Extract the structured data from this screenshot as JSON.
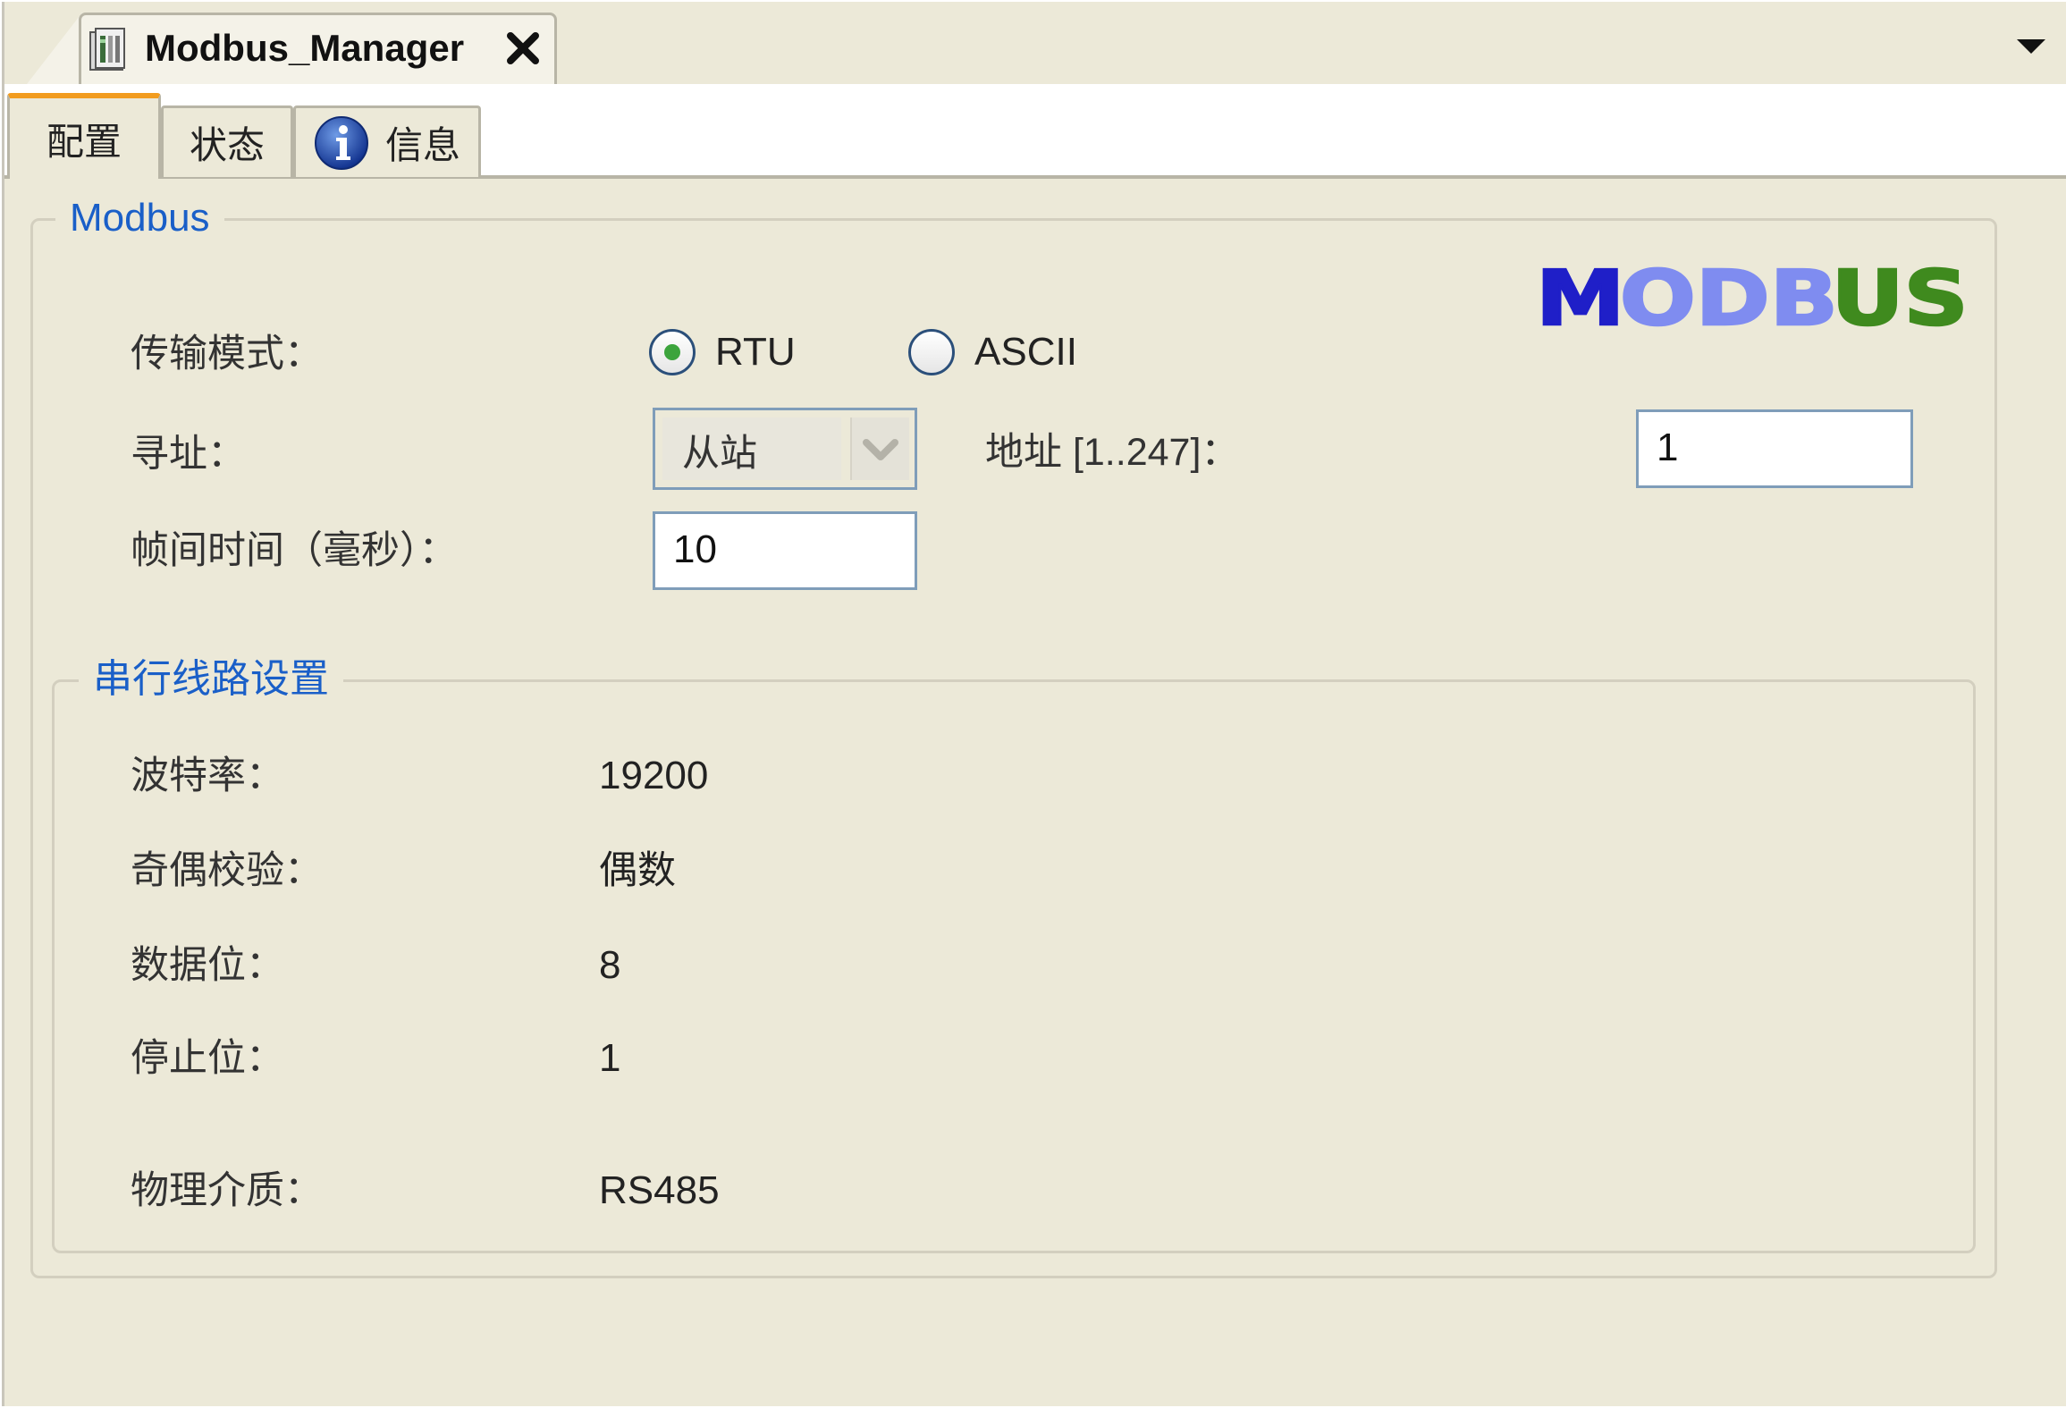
{
  "editor_tab": {
    "title": "Modbus_Manager",
    "icon": "device-manager-icon",
    "close_icon": "close-icon"
  },
  "tab_list_icon": "triangle-down-icon",
  "tabs": [
    {
      "label": "配置",
      "active": true
    },
    {
      "label": "状态",
      "active": false
    },
    {
      "label": "信息",
      "active": false,
      "icon": "info-icon"
    }
  ],
  "modbus_group": {
    "legend": "Modbus",
    "logo_text": "MODBUS",
    "transmission_mode": {
      "label": "传输模式：",
      "options": [
        {
          "label": "RTU",
          "selected": true
        },
        {
          "label": "ASCII",
          "selected": false
        }
      ]
    },
    "addressing": {
      "label": "寻址：",
      "value": "从站"
    },
    "address": {
      "label": "地址 [1..247]：",
      "value": "1"
    },
    "inter_frame_delay": {
      "label": "帧间时间（毫秒）：",
      "value": "10"
    }
  },
  "serial_group": {
    "legend": "串行线路设置",
    "rows": [
      {
        "label": "波特率：",
        "value": "19200"
      },
      {
        "label": "奇偶校验：",
        "value": "偶数"
      },
      {
        "label": "数据位：",
        "value": "8"
      },
      {
        "label": "停止位：",
        "value": "1"
      },
      {
        "label": "物理介质：",
        "value": "RS485"
      }
    ]
  },
  "colors": {
    "panel_bg": "#ece9d8",
    "legend_blue": "#1a5fc8",
    "active_tab_accent": "#f29c1f",
    "radio_selected": "#3ca43c",
    "logo_dark_blue": "#1f1fc8",
    "logo_light_blue": "#7f8cf0",
    "logo_green": "#3f8a1e"
  }
}
